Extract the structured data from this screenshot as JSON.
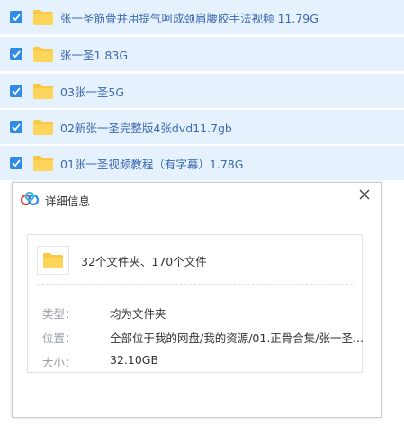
{
  "file_list": {
    "items": [
      {
        "name": "张一圣筋骨并用提气呵成颈肩腰胶手法视频 11.79G",
        "checked": true
      },
      {
        "name": "张一圣1.83G",
        "checked": true
      },
      {
        "name": "03张一圣5G",
        "checked": true
      },
      {
        "name": "02新张一圣完整版4张dvd11.7gb",
        "checked": true
      },
      {
        "name": "01张一圣视频教程（有字幕）1.78G",
        "checked": true
      }
    ]
  },
  "dialog": {
    "title": "详细信息",
    "summary": "32个文件夹、170个文件",
    "type_label": "类型：",
    "type_value": "均为文件夹",
    "location_label": "位置：",
    "location_value": "全部位于我的网盘/我的资源/01.正骨合集/张一圣...",
    "size_label": "大小：",
    "size_value": "32.10GB"
  },
  "colors": {
    "row_bg": "#e6f1fe",
    "checkbox": "#2e8be8",
    "folder": "#f9c844",
    "file_text": "#3a6ab0"
  },
  "icons": {
    "checkbox": "checkbox-checked-icon",
    "folder": "folder-icon",
    "logo": "baidu-netdisk-logo-icon",
    "close": "close-icon"
  }
}
